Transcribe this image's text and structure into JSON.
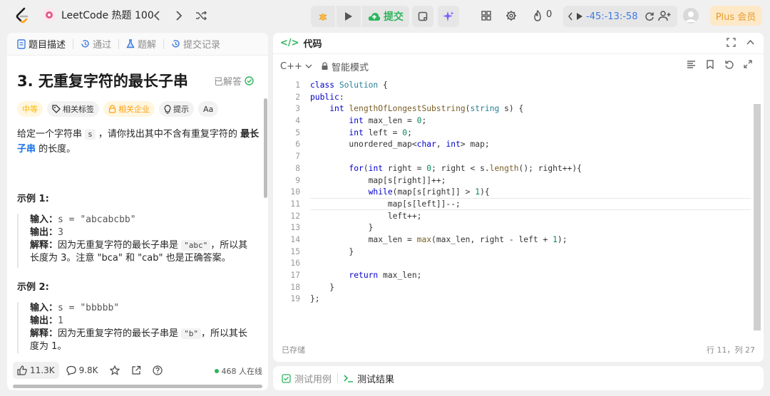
{
  "header": {
    "problem_list": "LeetCode 热题 100",
    "submit_label": "提交",
    "fire_count": "0",
    "timer": "-45:-13:-58",
    "plus_label": "Plus 会员"
  },
  "left_tabs": [
    "题目描述",
    "通过",
    "题解",
    "提交记录"
  ],
  "problem": {
    "title": "3. 无重复字符的最长子串",
    "solved_label": "已解答",
    "chips": [
      "中等",
      "相关标签",
      "相关企业",
      "提示",
      "Aa"
    ],
    "desc_part1": "给定一个字符串",
    "desc_code": "s",
    "desc_part2": "，请你找出其中不含有重复字符的",
    "desc_bold": "最长",
    "desc_link": "子串",
    "desc_part3": "的长度。"
  },
  "examples": [
    {
      "title": "示例 1:",
      "input_label": "输入：",
      "input": "s = \"abcabcbb\"",
      "output_label": "输出：",
      "output": "3",
      "explain_label": "解释：",
      "explain_a": "因为无重复字符的最长子串是",
      "explain_code": "\"abc\"",
      "explain_b": "，所以其",
      "explain_c": "长度为 3。注意 \"bca\" 和 \"cab\" 也是正确答案。"
    },
    {
      "title": "示例 2:",
      "input_label": "输入：",
      "input": "s = \"bbbbb\"",
      "output_label": "输出：",
      "output": "1",
      "explain_label": "解释：",
      "explain_a": "因为无重复字符的最长子串是",
      "explain_code": "\"b\"",
      "explain_b": "，所以其长",
      "explain_c": "度为 1。"
    }
  ],
  "footer": {
    "likes": "11.3K",
    "comments": "9.8K",
    "online": "468 人在线"
  },
  "code_panel": {
    "title": "代码",
    "language": "C++",
    "mode": "智能模式",
    "saved": "已存储",
    "cursor_pos": "行 11，列 27"
  },
  "bottom_tabs": [
    "测试用例",
    "测试结果"
  ],
  "icons": {
    "brand": "leetcode-logo",
    "accent_green": "#2db55d",
    "accent_orange": "#ffa116"
  }
}
